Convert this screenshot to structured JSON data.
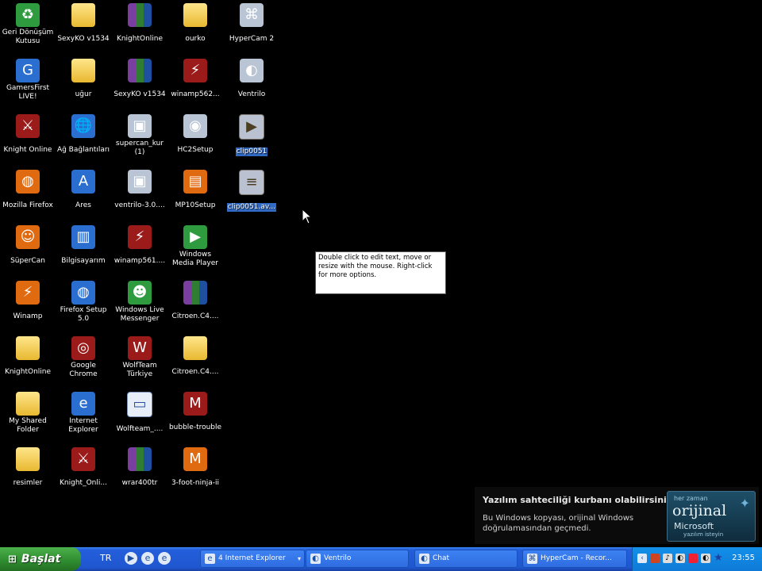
{
  "desktop": {
    "icons": [
      {
        "label": "Geri Dönüşüm Kutusu",
        "icon": "recycle-bin-icon",
        "glyph": "♻",
        "cls": "green",
        "col": 0,
        "row": 0
      },
      {
        "label": "SexyKO v1534",
        "icon": "folder-icon",
        "glyph": "",
        "cls": "folder",
        "col": 1,
        "row": 0
      },
      {
        "label": "KnightOnline",
        "icon": "archive-icon",
        "glyph": "",
        "cls": "archive",
        "col": 2,
        "row": 0
      },
      {
        "label": "ourko",
        "icon": "folder-icon",
        "glyph": "",
        "cls": "folder",
        "col": 3,
        "row": 0
      },
      {
        "label": "HyperCam 2",
        "icon": "hypercam-icon",
        "glyph": "⌘",
        "cls": "gray",
        "col": 4,
        "row": 0
      },
      {
        "label": "GamersFirst LIVE!",
        "icon": "gamersfirst-icon",
        "glyph": "G",
        "cls": "blue",
        "col": 0,
        "row": 1
      },
      {
        "label": "uğur",
        "icon": "folder-icon",
        "glyph": "",
        "cls": "folder",
        "col": 1,
        "row": 1
      },
      {
        "label": "SexyKO v1534",
        "icon": "archive-icon",
        "glyph": "",
        "cls": "archive",
        "col": 2,
        "row": 1
      },
      {
        "label": "winamp562...",
        "icon": "winamp-installer-icon",
        "glyph": "⚡",
        "cls": "red",
        "col": 3,
        "row": 1
      },
      {
        "label": "Ventrilo",
        "icon": "ventrilo-icon",
        "glyph": "◐",
        "cls": "gray",
        "col": 4,
        "row": 1
      },
      {
        "label": "Knight Online",
        "icon": "knight-online-icon",
        "glyph": "⚔",
        "cls": "red",
        "col": 0,
        "row": 2
      },
      {
        "label": "Ağ Bağlantıları",
        "icon": "network-connections-icon",
        "glyph": "🌐",
        "cls": "blue",
        "col": 1,
        "row": 2
      },
      {
        "label": "supercan_kur (1)",
        "icon": "installer-icon",
        "glyph": "▣",
        "cls": "gray",
        "col": 2,
        "row": 2
      },
      {
        "label": "HC2Setup",
        "icon": "camera-setup-icon",
        "glyph": "◉",
        "cls": "gray",
        "col": 3,
        "row": 2
      },
      {
        "label": "clip0051",
        "icon": "video-clip-icon",
        "glyph": "▶",
        "cls": "doc",
        "col": 4,
        "row": 2,
        "selected": true
      },
      {
        "label": "Mozilla Firefox",
        "icon": "firefox-icon",
        "glyph": "◍",
        "cls": "orange",
        "col": 0,
        "row": 3
      },
      {
        "label": "Ares",
        "icon": "ares-icon",
        "glyph": "A",
        "cls": "blue",
        "col": 1,
        "row": 3
      },
      {
        "label": "ventrilo-3.0....",
        "icon": "installer-icon",
        "glyph": "▣",
        "cls": "gray",
        "col": 2,
        "row": 3
      },
      {
        "label": "MP10Setup",
        "icon": "media-player-setup-icon",
        "glyph": "▤",
        "cls": "orange",
        "col": 3,
        "row": 3
      },
      {
        "label": "clip0051.av...",
        "icon": "avi-file-icon",
        "glyph": "≡",
        "cls": "doc",
        "col": 4,
        "row": 3,
        "selected": true
      },
      {
        "label": "SüperCan",
        "icon": "supercan-icon",
        "glyph": "☺",
        "cls": "orange",
        "col": 0,
        "row": 4
      },
      {
        "label": "Bilgisayarım",
        "icon": "my-computer-icon",
        "glyph": "▥",
        "cls": "blue",
        "col": 1,
        "row": 4
      },
      {
        "label": "winamp561....",
        "icon": "winamp-installer-icon",
        "glyph": "⚡",
        "cls": "red",
        "col": 2,
        "row": 4
      },
      {
        "label": "Windows Media Player",
        "icon": "windows-media-player-icon",
        "glyph": "▶",
        "cls": "green",
        "col": 3,
        "row": 4
      },
      {
        "label": "Winamp",
        "icon": "winamp-icon",
        "glyph": "⚡",
        "cls": "orange",
        "col": 0,
        "row": 5
      },
      {
        "label": "Firefox Setup 5.0",
        "icon": "firefox-setup-icon",
        "glyph": "◍",
        "cls": "blue",
        "col": 1,
        "row": 5
      },
      {
        "label": "Windows Live Messenger",
        "icon": "messenger-icon",
        "glyph": "☻",
        "cls": "green",
        "col": 2,
        "row": 5
      },
      {
        "label": "Citroen.C4....",
        "icon": "archive-icon",
        "glyph": "",
        "cls": "archive",
        "col": 3,
        "row": 5
      },
      {
        "label": "KnightOnline",
        "icon": "folder-icon",
        "glyph": "",
        "cls": "folder",
        "col": 0,
        "row": 6
      },
      {
        "label": "Google Chrome",
        "icon": "chrome-icon",
        "glyph": "◎",
        "cls": "red",
        "col": 1,
        "row": 6
      },
      {
        "label": "WolfTeam Türkiye",
        "icon": "wolfteam-icon",
        "glyph": "W",
        "cls": "red",
        "col": 2,
        "row": 6
      },
      {
        "label": "Citroen.C4....",
        "icon": "folder-icon",
        "glyph": "",
        "cls": "folder",
        "col": 3,
        "row": 6
      },
      {
        "label": "My Shared Folder",
        "icon": "folder-icon",
        "glyph": "",
        "cls": "folder",
        "col": 0,
        "row": 7
      },
      {
        "label": "Internet Explorer",
        "icon": "internet-explorer-icon",
        "glyph": "e",
        "cls": "blue",
        "col": 1,
        "row": 7
      },
      {
        "label": "Wolfteam_....",
        "icon": "window-file-icon",
        "glyph": "▭",
        "cls": "doc",
        "col": 2,
        "row": 7
      },
      {
        "label": "bubble-trouble",
        "icon": "bubble-trouble-icon",
        "glyph": "M",
        "cls": "red",
        "col": 3,
        "row": 7
      },
      {
        "label": "resimler",
        "icon": "folder-icon",
        "glyph": "",
        "cls": "folder",
        "col": 0,
        "row": 8
      },
      {
        "label": "Knight_Onli...",
        "icon": "knight-online-icon",
        "glyph": "⚔",
        "cls": "red",
        "col": 1,
        "row": 8
      },
      {
        "label": "wrar400tr",
        "icon": "winrar-icon",
        "glyph": "",
        "cls": "archive",
        "col": 2,
        "row": 8
      },
      {
        "label": "3-foot-ninja-ii",
        "icon": "game-icon",
        "glyph": "M",
        "cls": "orange",
        "col": 3,
        "row": 8
      }
    ]
  },
  "tooltip": {
    "text": "Double click to edit text, move or resize with the mouse. Right-click for more options."
  },
  "watermark": {
    "title": "Yazılım sahteciliği kurbanı olabilirsiniz.",
    "body": "Bu Windows kopyası, orijinal Windows doğrulamasından geçmedi.",
    "badge_top": "her zaman",
    "badge_main": "orijinal",
    "badge_brand": "Microsoft",
    "badge_bottom": "yazılım isteyin"
  },
  "taskbar": {
    "start_label": "Başlat",
    "language": "TR",
    "tasks": [
      {
        "label": "4 Internet Explorer",
        "icon": "internet-explorer-icon",
        "glyph": "e",
        "has_dropdown": true
      },
      {
        "label": "Ventrilo",
        "icon": "ventrilo-icon",
        "glyph": "◐",
        "has_dropdown": false
      },
      {
        "label": "Chat",
        "icon": "chat-icon",
        "glyph": "◐",
        "has_dropdown": false
      },
      {
        "label": "HyperCam - Recor...",
        "icon": "hypercam-icon",
        "glyph": "⌘",
        "has_dropdown": false
      }
    ],
    "clock": "23:55"
  }
}
